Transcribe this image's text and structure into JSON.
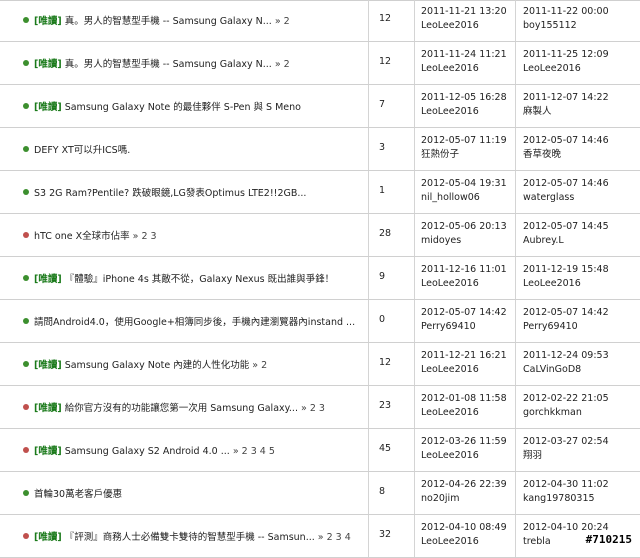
{
  "colors": {
    "dot_green": "#3c8f2e",
    "dot_red": "#c0504d",
    "tag": "#1a7a1a"
  },
  "rows": [
    {
      "dot": "green",
      "tag": "[唯讀]",
      "title": " 真。男人的智慧型手機 -- Samsung Galaxy N...",
      "pages": " » 2",
      "replies": "12",
      "created": "2011-11-21 13:20",
      "author": "LeoLee2016",
      "last": "2011-11-22 00:00",
      "last_user": "boy155112"
    },
    {
      "dot": "green",
      "tag": "[唯讀]",
      "title": " 真。男人的智慧型手機 -- Samsung Galaxy N...",
      "pages": " » 2",
      "replies": "12",
      "created": "2011-11-24 11:21",
      "author": "LeoLee2016",
      "last": "2011-11-25 12:09",
      "last_user": "LeoLee2016"
    },
    {
      "dot": "green",
      "tag": "[唯讀]",
      "title": " Samsung Galaxy Note 的最佳夥伴 S-Pen 與 S Meno",
      "pages": "",
      "replies": "7",
      "created": "2011-12-05 16:28",
      "author": "LeoLee2016",
      "last": "2011-12-07 14:22",
      "last_user": "麻製人"
    },
    {
      "dot": "green",
      "tag": "",
      "title": "DEFY XT可以升ICS嗎.",
      "pages": "",
      "replies": "3",
      "created": "2012-05-07 11:19",
      "author": "狂熱份子",
      "last": "2012-05-07 14:46",
      "last_user": "香草夜晚"
    },
    {
      "dot": "green",
      "tag": "",
      "title": "S3 2G Ram?Pentile? 跌破眼鏡,LG發表Optimus LTE2!!2GB...",
      "pages": "",
      "replies": "1",
      "created": "2012-05-04 19:31",
      "author": "nil_hollow06",
      "last": "2012-05-07 14:46",
      "last_user": "waterglass"
    },
    {
      "dot": "red",
      "tag": "",
      "title": "hTC one X全球市佔率",
      "pages": " » 2 3",
      "replies": "28",
      "created": "2012-05-06 20:13",
      "author": "midoyes",
      "last": "2012-05-07 14:45",
      "last_user": "Aubrey.L"
    },
    {
      "dot": "green",
      "tag": "[唯讀]",
      "title": " 『體驗』iPhone 4s 其敵不從，Galaxy Nexus 既出誰與爭鋒！",
      "pages": "",
      "replies": "9",
      "created": "2011-12-16 11:01",
      "author": "LeoLee2016",
      "last": "2011-12-19 15:48",
      "last_user": "LeoLee2016"
    },
    {
      "dot": "green",
      "tag": "",
      "title": "請問Android4.0，使用Google+相簿同步後，手機內建瀏覽器內instand ...",
      "pages": "",
      "replies": "0",
      "created": "2012-05-07 14:42",
      "author": "Perry69410",
      "last": "2012-05-07 14:42",
      "last_user": "Perry69410"
    },
    {
      "dot": "green",
      "tag": "[唯讀]",
      "title": " Samsung Galaxy Note 內建的人性化功能",
      "pages": " » 2",
      "replies": "12",
      "created": "2011-12-21 16:21",
      "author": "LeoLee2016",
      "last": "2011-12-24 09:53",
      "last_user": "CaLVinGoD8"
    },
    {
      "dot": "red",
      "tag": "[唯讀]",
      "title": " 給你官方沒有的功能讓您第一次用 Samsung Galaxy...",
      "pages": " » 2 3",
      "replies": "23",
      "created": "2012-01-08 11:58",
      "author": "LeoLee2016",
      "last": "2012-02-22 21:05",
      "last_user": "gorchkkman"
    },
    {
      "dot": "red",
      "tag": "[唯讀]",
      "title": " Samsung Galaxy S2 Android 4.0 ...",
      "pages": " » 2 3 4 5",
      "replies": "45",
      "created": "2012-03-26 11:59",
      "author": "LeoLee2016",
      "last": "2012-03-27 02:54",
      "last_user": "翔羽"
    },
    {
      "dot": "green",
      "tag": "",
      "title": "首輪30萬老客戶優惠",
      "pages": "",
      "replies": "8",
      "created": "2012-04-26 22:39",
      "author": "no20jim",
      "last": "2012-04-30 11:02",
      "last_user": "kang19780315"
    },
    {
      "dot": "red",
      "tag": "[唯讀]",
      "title": " 『評測』商務人士必備雙卡雙待的智慧型手機 -- Samsun...",
      "pages": " » 2 3 4",
      "replies": "32",
      "created": "2012-04-10 08:49",
      "author": "LeoLee2016",
      "last": "2012-04-10 20:24",
      "last_user": "trebla"
    }
  ],
  "watermark": "#710215"
}
